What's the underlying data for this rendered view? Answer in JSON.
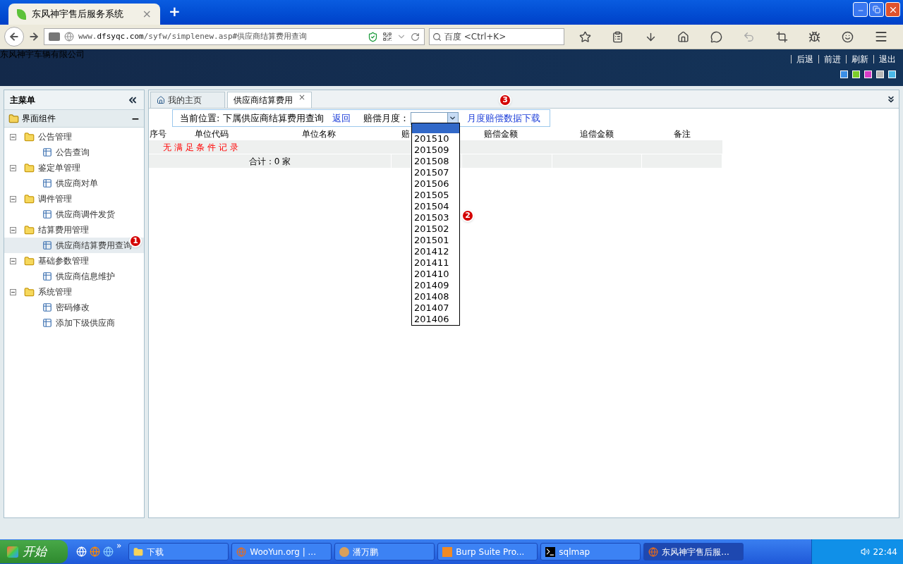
{
  "browser": {
    "tab_title": "东风神宇售后服务系统",
    "tab_close": "×",
    "new_tab": "+",
    "url_prefix": "www.",
    "url_domain": "dfsyqc.com",
    "url_path": "/syfw/simplenew.asp#供应商结算费用查询",
    "search_placeholder": "百度 <Ctrl+K>"
  },
  "header": {
    "company": "东风神宇车辆有限公司",
    "links": [
      "后退",
      "前进",
      "刷新",
      "退出"
    ],
    "swatches": [
      {
        "color": "#3a8ee6"
      },
      {
        "color": "#7ccc2a"
      },
      {
        "color": "#d63cc8"
      },
      {
        "color": "#b8b8b8"
      },
      {
        "color": "#4ab8e8"
      }
    ]
  },
  "sidebar": {
    "title": "主菜单",
    "section": "界面组件",
    "collapse": "−",
    "tree": [
      {
        "label": "公告管理",
        "expanded": true,
        "children": [
          {
            "label": "公告查询",
            "selected": false
          }
        ]
      },
      {
        "label": "鉴定单管理",
        "expanded": true,
        "children": [
          {
            "label": "供应商对单",
            "selected": false
          }
        ]
      },
      {
        "label": "调件管理",
        "expanded": true,
        "children": [
          {
            "label": "供应商调件发货",
            "selected": false
          }
        ]
      },
      {
        "label": "结算费用管理",
        "expanded": true,
        "children": [
          {
            "label": "供应商结算费用查询",
            "selected": true
          }
        ]
      },
      {
        "label": "基础参数管理",
        "expanded": true,
        "children": [
          {
            "label": "供应商信息维护",
            "selected": false
          }
        ]
      },
      {
        "label": "系统管理",
        "expanded": true,
        "children": [
          {
            "label": "密码修改",
            "selected": false
          },
          {
            "label": "添加下级供应商",
            "selected": false
          }
        ]
      }
    ]
  },
  "tabs": [
    {
      "label": "我的主页",
      "selected": false
    },
    {
      "label": "供应商结算费用",
      "selected": true,
      "close": "×"
    }
  ],
  "breadcrumb": {
    "text": "当前位置: 下属供应商结算费用查询",
    "back": "返回",
    "month_label": "赔偿月度：",
    "download": "月度赔偿数据下载"
  },
  "month_select": {
    "open": true,
    "blank_highlighted": true,
    "options": [
      {
        "label": "201510",
        "selected": false
      },
      {
        "label": "201509",
        "selected": false
      },
      {
        "label": "201508",
        "selected": false
      },
      {
        "label": "201507",
        "selected": false
      },
      {
        "label": "201506",
        "selected": false
      },
      {
        "label": "201505",
        "selected": false
      },
      {
        "label": "201504",
        "selected": false
      },
      {
        "label": "201503",
        "selected": false
      },
      {
        "label": "201502",
        "selected": false
      },
      {
        "label": "201501",
        "selected": false
      },
      {
        "label": "201412",
        "selected": false
      },
      {
        "label": "201411",
        "selected": false
      },
      {
        "label": "201410",
        "selected": false
      },
      {
        "label": "201409",
        "selected": false
      },
      {
        "label": "201408",
        "selected": false
      },
      {
        "label": "201407",
        "selected": false
      },
      {
        "label": "201406",
        "selected": false
      }
    ]
  },
  "table": {
    "columns": [
      "序号",
      "单位代码",
      "单位名称",
      "赔",
      "赔偿金额",
      "追偿金额",
      "备注"
    ],
    "empty_message": "无 满 足 条 件 记 录",
    "total": "合计：0 家"
  },
  "annotations": [
    "1",
    "2",
    "3"
  ],
  "taskbar": {
    "start": "开始",
    "more": "»",
    "tasks": [
      {
        "label": "下载",
        "selected": false,
        "kind": "folder"
      },
      {
        "label": "WooYun.org | ...",
        "selected": false,
        "kind": "browser"
      },
      {
        "label": "潘万鹏",
        "selected": false,
        "kind": "chat"
      },
      {
        "label": "Burp Suite Pro...",
        "selected": false,
        "kind": "burp"
      },
      {
        "label": "sqlmap",
        "selected": false,
        "kind": "console"
      },
      {
        "label": "东风神宇售后服...",
        "selected": true,
        "kind": "browser"
      }
    ],
    "clock": "22:44"
  }
}
